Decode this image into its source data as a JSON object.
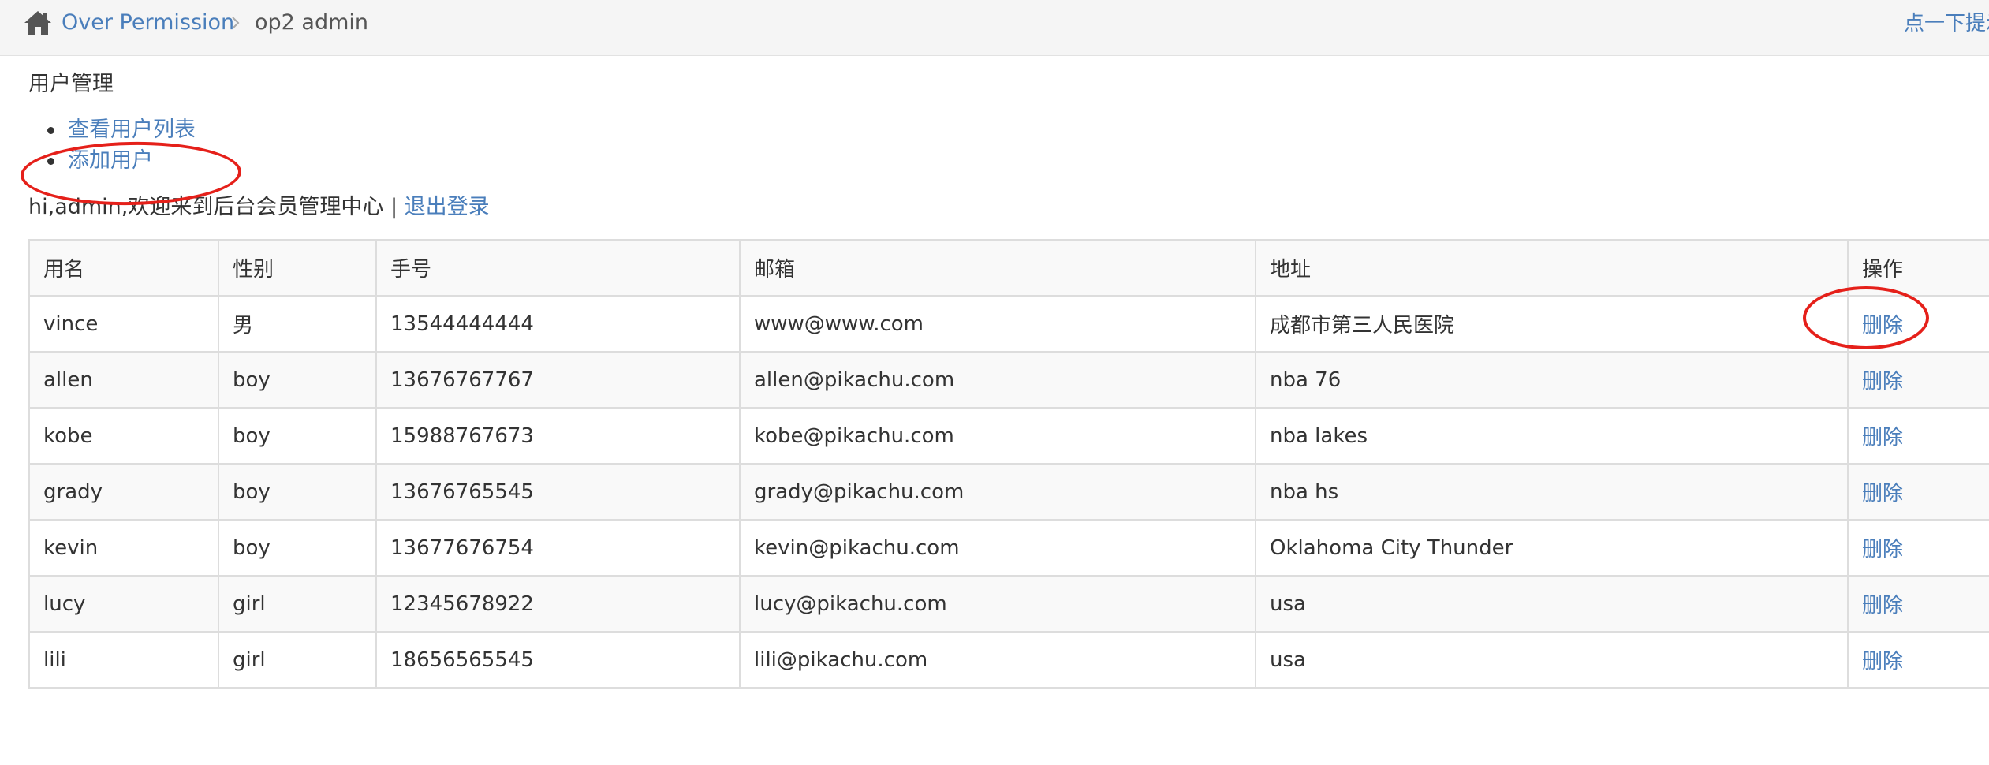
{
  "breadcrumb": {
    "home_icon": "home-icon",
    "link": "Over Permission",
    "current": "op2 admin",
    "top_right": "点一下提示"
  },
  "section": {
    "title": "用户管理",
    "menu": [
      {
        "label": "查看用户列表"
      },
      {
        "label": "添加用户"
      }
    ]
  },
  "welcome": {
    "text": "hi,admin,欢迎来到后台会员管理中心 | ",
    "logout": "退出登录"
  },
  "table": {
    "headers": [
      "用名",
      "性别",
      "手号",
      "邮箱",
      "地址",
      "操作"
    ],
    "rows": [
      {
        "name": "vince",
        "sex": "男",
        "phone": "13544444444",
        "email": "www@www.com",
        "address": "成都市第三人民医院",
        "action": "删除"
      },
      {
        "name": "allen",
        "sex": "boy",
        "phone": "13676767767",
        "email": "allen@pikachu.com",
        "address": "nba 76",
        "action": "删除"
      },
      {
        "name": "kobe",
        "sex": "boy",
        "phone": "15988767673",
        "email": "kobe@pikachu.com",
        "address": "nba lakes",
        "action": "删除"
      },
      {
        "name": "grady",
        "sex": "boy",
        "phone": "13676765545",
        "email": "grady@pikachu.com",
        "address": "nba hs",
        "action": "删除"
      },
      {
        "name": "kevin",
        "sex": "boy",
        "phone": "13677676754",
        "email": "kevin@pikachu.com",
        "address": "Oklahoma City Thunder",
        "action": "删除"
      },
      {
        "name": "lucy",
        "sex": "girl",
        "phone": "12345678922",
        "email": "lucy@pikachu.com",
        "address": "usa",
        "action": "删除"
      },
      {
        "name": "lili",
        "sex": "girl",
        "phone": "18656565545",
        "email": "lili@pikachu.com",
        "address": "usa",
        "action": "删除"
      }
    ]
  },
  "colors": {
    "link": "#4a7ebb",
    "annotation": "#e5201a",
    "breadcrumb_bg": "#f5f5f5",
    "stripe": "#f9f9f9"
  }
}
